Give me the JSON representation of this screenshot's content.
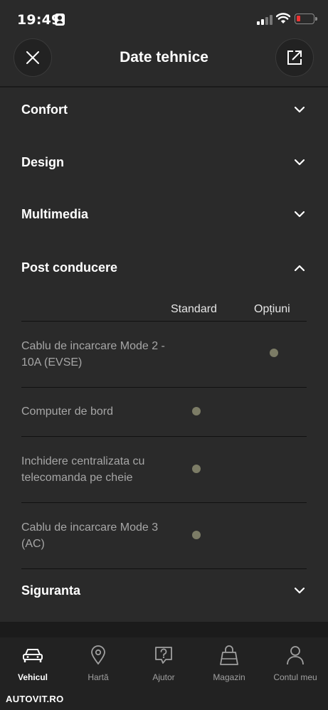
{
  "status": {
    "time": "19:49"
  },
  "header": {
    "title": "Date tehnice"
  },
  "sections": {
    "confort": "Confort",
    "design": "Design",
    "multimedia": "Multimedia",
    "post_conducere": "Post conducere",
    "siguranta": "Siguranta"
  },
  "table": {
    "col_standard": "Standard",
    "col_options": "Opțiuni",
    "rows": [
      {
        "label": "Cablu de incarcare Mode 2 - 10A (EVSE)",
        "standard": false,
        "option": true
      },
      {
        "label": "Computer de bord",
        "standard": true,
        "option": false
      },
      {
        "label": "Inchidere centralizata cu telecomanda pe cheie",
        "standard": true,
        "option": false
      },
      {
        "label": "Cablu de incarcare Mode 3 (AC)",
        "standard": true,
        "option": false
      }
    ]
  },
  "tabs": {
    "vehicul": "Vehicul",
    "harta": "Hartă",
    "ajutor": "Ajutor",
    "magazin": "Magazin",
    "cont": "Contul meu"
  },
  "watermark": "AUTOVIT.RO",
  "colors": {
    "background": "#2a2a2a",
    "dot": "#7c7c66",
    "battery_low": "#ee3333"
  }
}
